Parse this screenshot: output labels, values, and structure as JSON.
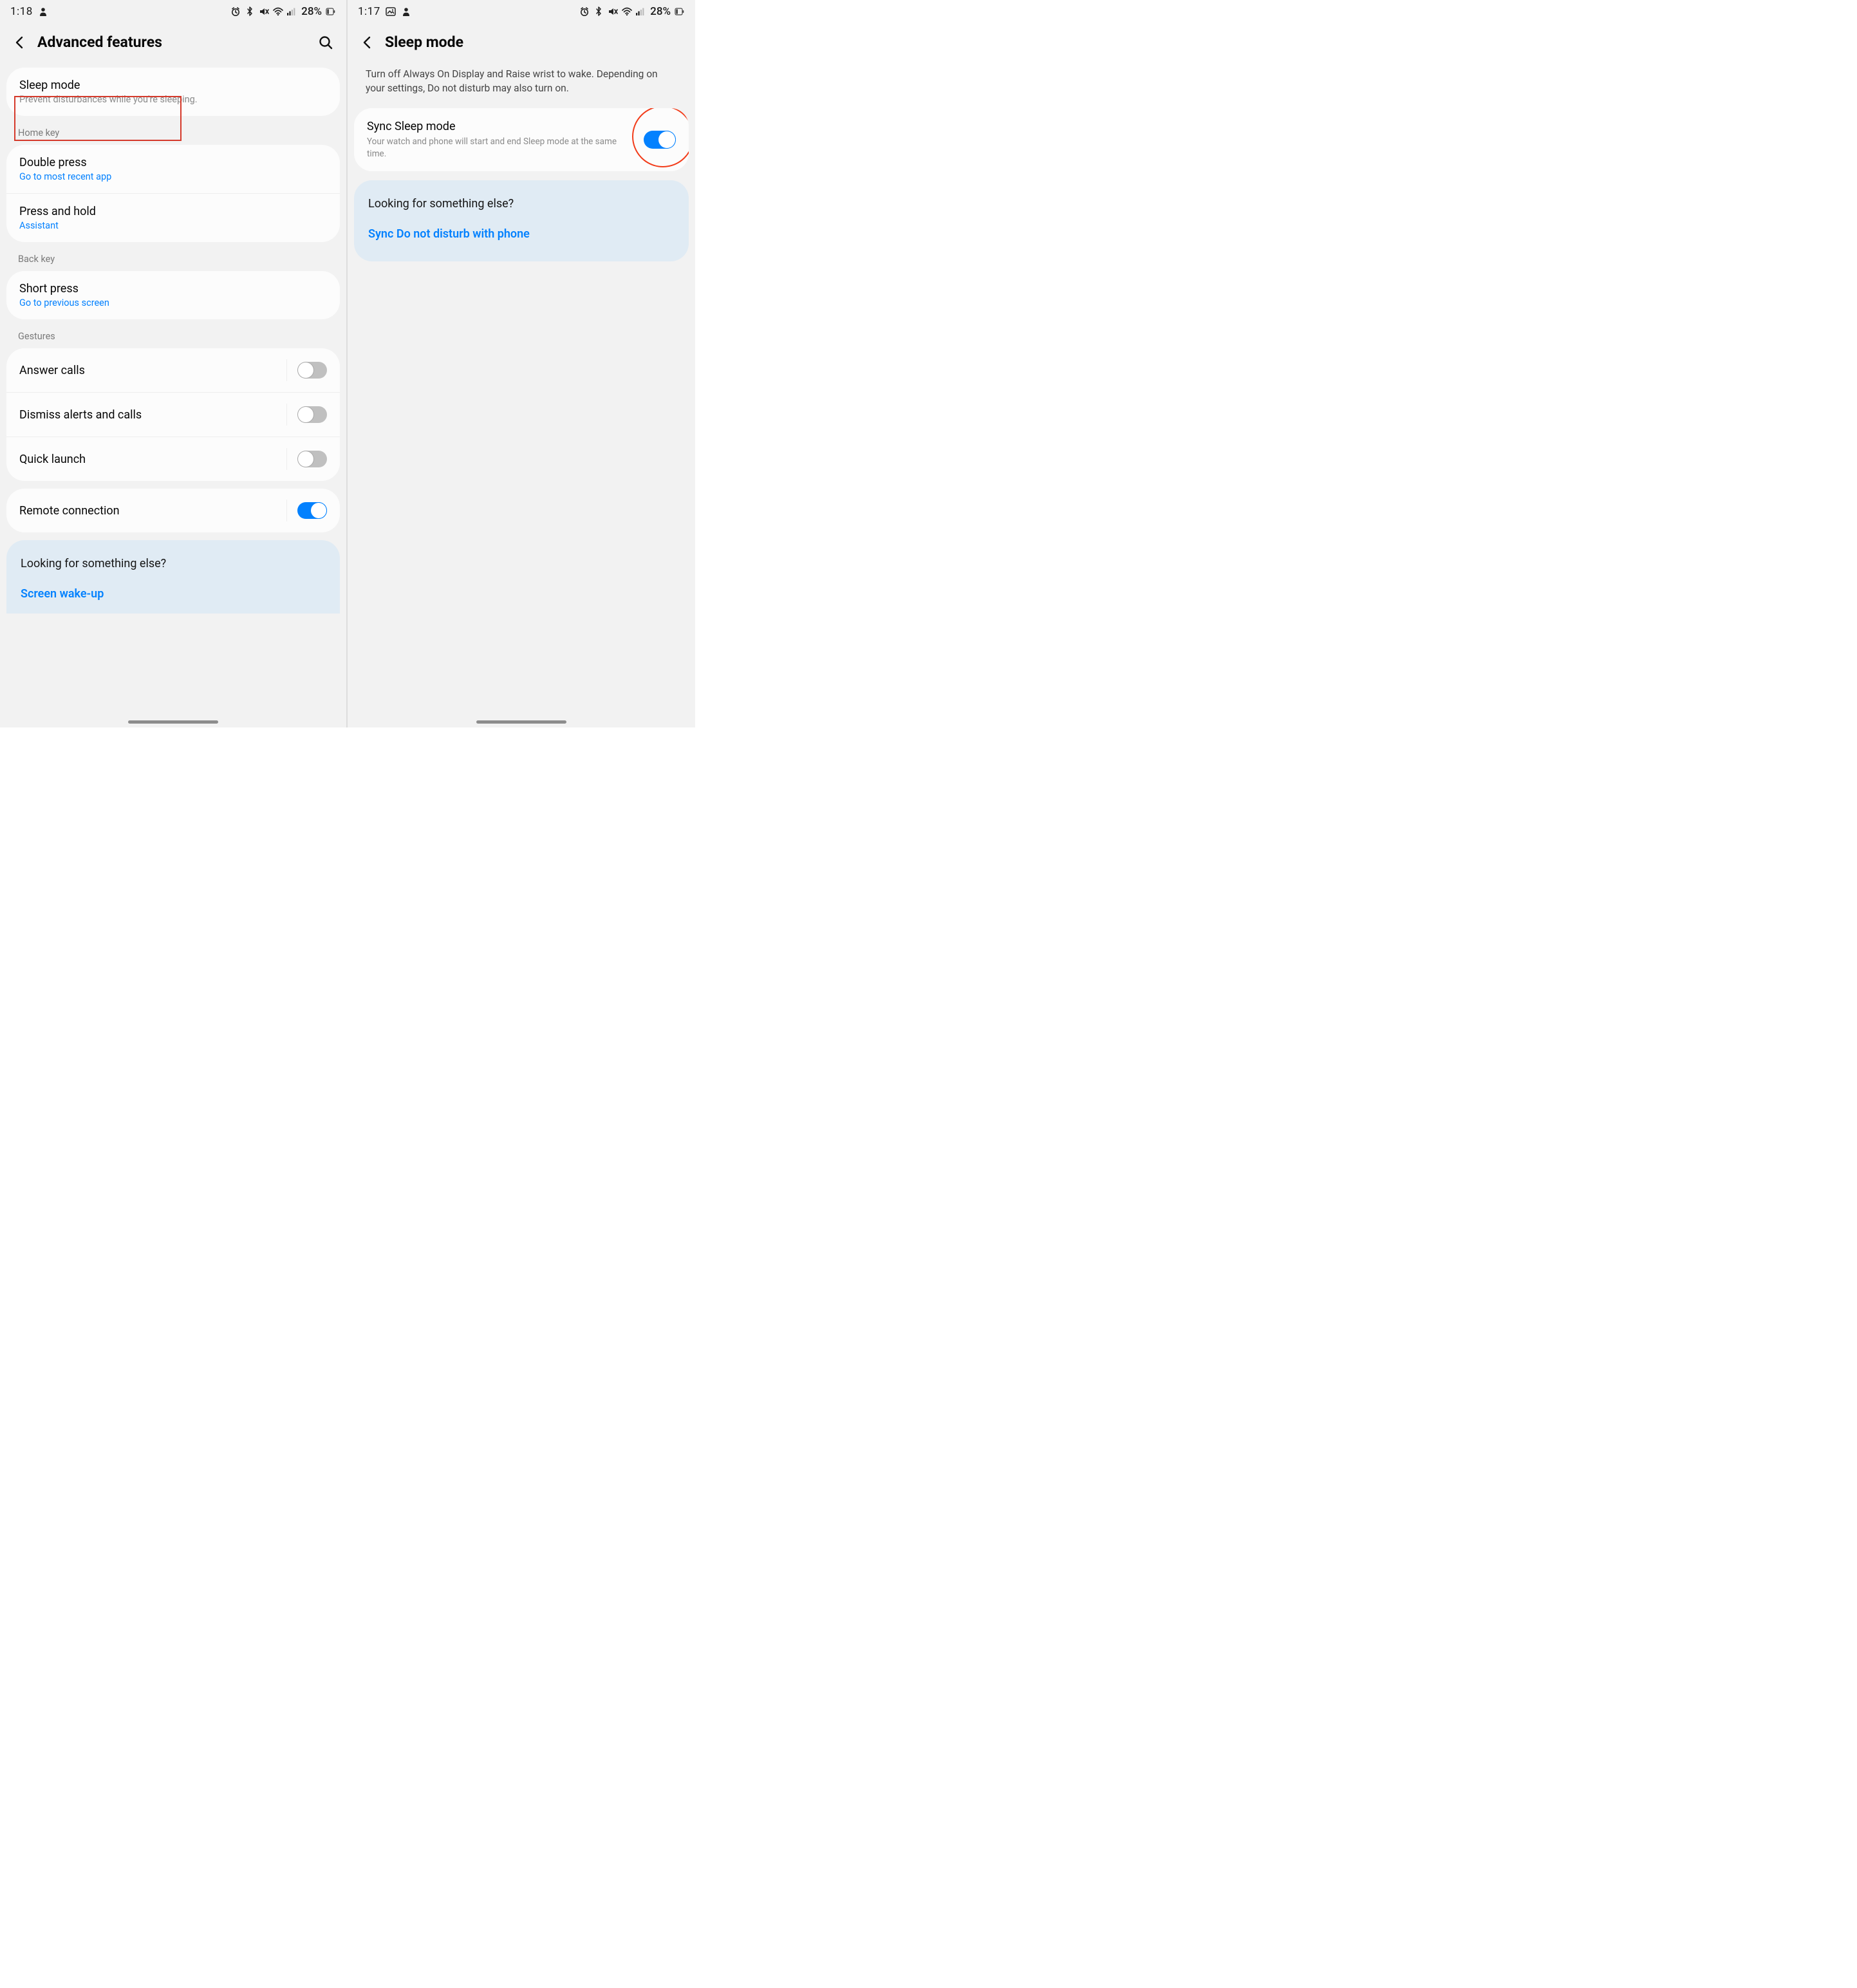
{
  "left": {
    "status": {
      "time": "1:18",
      "battery": "28%"
    },
    "header": {
      "title": "Advanced features"
    },
    "sleep": {
      "title": "Sleep mode",
      "sub": "Prevent disturbances while you're sleeping."
    },
    "section_home": "Home key",
    "double_press": {
      "title": "Double press",
      "sub": "Go to most recent app"
    },
    "press_hold": {
      "title": "Press and hold",
      "sub": "Assistant"
    },
    "section_back": "Back key",
    "short_press": {
      "title": "Short press",
      "sub": "Go to previous screen"
    },
    "section_gestures": "Gestures",
    "answer_calls": "Answer calls",
    "dismiss_alerts": "Dismiss alerts and calls",
    "quick_launch": "Quick launch",
    "remote_conn": "Remote connection",
    "help": {
      "title": "Looking for something else?",
      "link": "Screen wake-up"
    }
  },
  "right": {
    "status": {
      "time": "1:17",
      "battery": "28%"
    },
    "header": {
      "title": "Sleep mode"
    },
    "desc": "Turn off Always On Display and Raise wrist to wake. Depending on your settings, Do not disturb may also turn on.",
    "sync": {
      "title": "Sync Sleep mode",
      "sub": "Your watch and phone will start and end Sleep mode at the same time."
    },
    "help": {
      "title": "Looking for something else?",
      "link": "Sync Do not disturb with phone"
    }
  }
}
